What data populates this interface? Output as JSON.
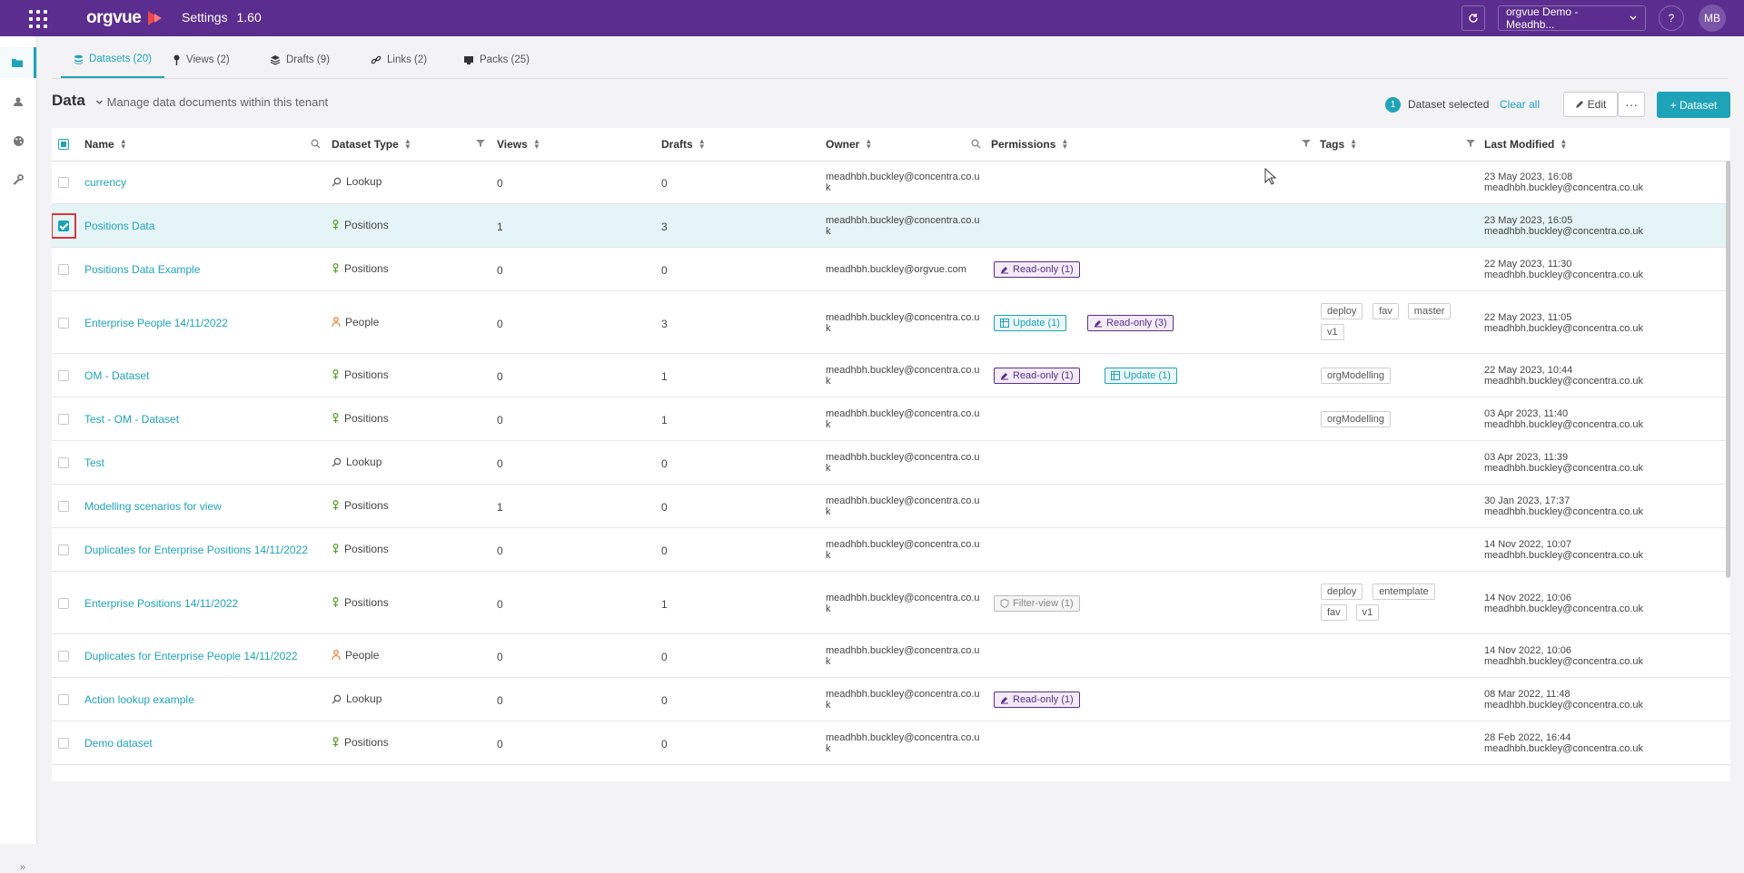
{
  "header": {
    "logo": "orgvue",
    "title": "Settings",
    "version": "1.60",
    "tenant": "orgvue Demo - Meadhb...",
    "help": "?",
    "avatar_initials": "MB"
  },
  "sidebar": {
    "icons": [
      "folder-icon",
      "user-icon",
      "palette-icon",
      "wrench-icon"
    ],
    "expand_label": "»"
  },
  "tabs": [
    {
      "label": "Datasets (20)",
      "icon": "stack-icon",
      "active": true
    },
    {
      "label": "Views (2)",
      "icon": "pin-icon"
    },
    {
      "label": "Drafts (9)",
      "icon": "layers-icon"
    },
    {
      "label": "Links (2)",
      "icon": "link-icon"
    },
    {
      "label": "Packs (25)",
      "icon": "pack-icon"
    }
  ],
  "toolbar": {
    "title": "Data",
    "subtitle": "Manage data documents within this tenant",
    "selected_count": "1",
    "selected_label": "Dataset selected",
    "clear_all": "Clear all",
    "edit": "Edit",
    "more": "···",
    "add_dataset": "+ Dataset"
  },
  "columns": [
    "Name",
    "Dataset Type",
    "Views",
    "Drafts",
    "Owner",
    "Permissions",
    "Tags",
    "Last Modified"
  ],
  "colors": {
    "brand": "#5b2d8e",
    "accent": "#1fa3b8",
    "people": "#e8843a",
    "positions": "#5aa02c"
  },
  "rows": [
    {
      "name": "currency",
      "type": "Lookup",
      "views": "0",
      "drafts": "0",
      "owner": "meadhbh.buckley@concentra.co.uk",
      "perms": [],
      "tags": [],
      "date": "23 May 2023, 16:08",
      "by": "meadhbh.buckley@concentra.co.uk"
    },
    {
      "name": "Positions Data",
      "type": "Positions",
      "views": "1",
      "drafts": "3",
      "owner": "meadhbh.buckley@concentra.co.uk",
      "perms": [],
      "tags": [],
      "date": "23 May 2023, 16:05",
      "by": "meadhbh.buckley@concentra.co.uk",
      "selected": true
    },
    {
      "name": "Positions Data Example",
      "type": "Positions",
      "views": "0",
      "drafts": "0",
      "owner": "meadhbh.buckley@orgvue.com",
      "perms": [
        {
          "k": "ro",
          "label": "Read-only (1)"
        }
      ],
      "tags": [],
      "date": "22 May 2023, 11:30",
      "by": "meadhbh.buckley@concentra.co.uk"
    },
    {
      "name": "Enterprise People 14/11/2022",
      "type": "People",
      "views": "0",
      "drafts": "3",
      "owner": "meadhbh.buckley@concentra.co.uk",
      "perms": [
        {
          "k": "up",
          "label": "Update (1)"
        },
        {
          "k": "ro",
          "label": "Read-only (3)"
        }
      ],
      "tags": [
        "deploy",
        "fav",
        "master",
        "v1"
      ],
      "date": "22 May 2023, 11:05",
      "by": "meadhbh.buckley@concentra.co.uk"
    },
    {
      "name": "OM - Dataset",
      "type": "Positions",
      "views": "0",
      "drafts": "1",
      "owner": "meadhbh.buckley@concentra.co.uk",
      "perms": [
        {
          "k": "ro",
          "label": "Read-only (1)"
        },
        {
          "k": "up",
          "label": "Update (1)"
        }
      ],
      "tags": [
        "orgModelling"
      ],
      "date": "22 May 2023, 10:44",
      "by": "meadhbh.buckley@concentra.co.uk"
    },
    {
      "name": "Test - OM - Dataset",
      "type": "Positions",
      "views": "0",
      "drafts": "1",
      "owner": "meadhbh.buckley@concentra.co.uk",
      "perms": [],
      "tags": [
        "orgModelling"
      ],
      "date": "03 Apr 2023, 11:40",
      "by": "meadhbh.buckley@concentra.co.uk"
    },
    {
      "name": "Test",
      "type": "Lookup",
      "views": "0",
      "drafts": "0",
      "owner": "meadhbh.buckley@concentra.co.uk",
      "perms": [],
      "tags": [],
      "date": "03 Apr 2023, 11:39",
      "by": "meadhbh.buckley@concentra.co.uk"
    },
    {
      "name": "Modelling scenarios for view",
      "type": "Positions",
      "views": "1",
      "drafts": "0",
      "owner": "meadhbh.buckley@concentra.co.uk",
      "perms": [],
      "tags": [],
      "date": "30 Jan 2023, 17:37",
      "by": "meadhbh.buckley@concentra.co.uk"
    },
    {
      "name": "Duplicates for Enterprise Positions 14/11/2022",
      "type": "Positions",
      "views": "0",
      "drafts": "0",
      "owner": "meadhbh.buckley@concentra.co.uk",
      "perms": [],
      "tags": [],
      "date": "14 Nov 2022, 10:07",
      "by": "meadhbh.buckley@concentra.co.uk"
    },
    {
      "name": "Enterprise Positions 14/11/2022",
      "type": "Positions",
      "views": "0",
      "drafts": "1",
      "owner": "meadhbh.buckley@concentra.co.uk",
      "perms": [
        {
          "k": "fv",
          "label": "Filter-view (1)"
        }
      ],
      "tags": [
        "deploy",
        "entemplate",
        "fav",
        "v1"
      ],
      "date": "14 Nov 2022, 10:06",
      "by": "meadhbh.buckley@concentra.co.uk"
    },
    {
      "name": "Duplicates for Enterprise People 14/11/2022",
      "type": "People",
      "views": "0",
      "drafts": "0",
      "owner": "meadhbh.buckley@concentra.co.uk",
      "perms": [],
      "tags": [],
      "date": "14 Nov 2022, 10:06",
      "by": "meadhbh.buckley@concentra.co.uk"
    },
    {
      "name": "Action lookup example",
      "type": "Lookup",
      "views": "0",
      "drafts": "0",
      "owner": "meadhbh.buckley@concentra.co.uk",
      "perms": [
        {
          "k": "ro",
          "label": "Read-only (1)"
        }
      ],
      "tags": [],
      "date": "08 Mar 2022, 11:48",
      "by": "meadhbh.buckley@concentra.co.uk"
    },
    {
      "name": "Demo dataset",
      "type": "Positions",
      "views": "0",
      "drafts": "0",
      "owner": "meadhbh.buckley@concentra.co.uk",
      "perms": [],
      "tags": [],
      "date": "28 Feb 2022, 16:44",
      "by": "meadhbh.buckley@concentra.co.uk"
    }
  ]
}
